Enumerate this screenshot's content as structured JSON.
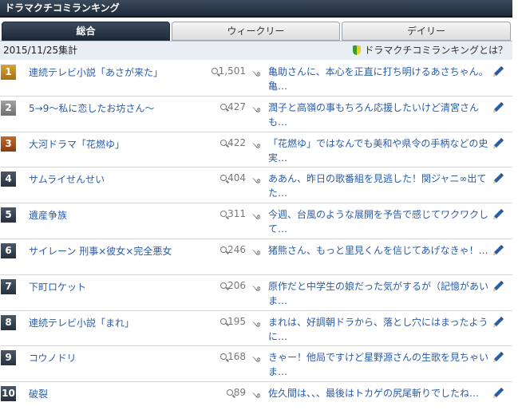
{
  "header": {
    "title": "ドラマクチコミランキング"
  },
  "tabs": [
    {
      "label": "総合",
      "active": true
    },
    {
      "label": "ウィークリー",
      "active": false
    },
    {
      "label": "デイリー",
      "active": false
    }
  ],
  "info": {
    "date": "2015/11/25集計",
    "help_link": "ドラマクチコミランキングとは？"
  },
  "rows": [
    {
      "rank": "1",
      "title": "連続テレビ小説「あさが来た」",
      "count": "1,501",
      "comment": "亀助さんに、本心を正直に打ち明けるあさちゃん。亀…"
    },
    {
      "rank": "2",
      "title": "5→9～私に恋したお坊さん～",
      "count": "427",
      "comment": "潤子と高嶺の事もちろん応援したいけど清宮さんも…"
    },
    {
      "rank": "3",
      "title": "大河ドラマ「花燃ゆ」",
      "count": "422",
      "comment": "「花燃ゆ」ではなんでも美和や県令の手柄などの史実…"
    },
    {
      "rank": "4",
      "title": "サムライせんせい",
      "count": "404",
      "comment": "ああん、昨日の歌番組を見逃した！関ジャニ∞出てた…"
    },
    {
      "rank": "5",
      "title": "遺産争族",
      "count": "311",
      "comment": "今週、台風のような展開を予告で感じてワクワクして…"
    },
    {
      "rank": "6",
      "title": "サイレーン 刑事×彼女×完全悪女",
      "count": "246",
      "comment": "猪熊さん、もっと里見くんを信じてあげなきゃ！…"
    },
    {
      "rank": "7",
      "title": "下町ロケット",
      "count": "206",
      "comment": "原作だと中学生の娘だった気がするが（記憶があいま…"
    },
    {
      "rank": "8",
      "title": "連続テレビ小説「まれ」",
      "count": "195",
      "comment": "まれは、好調朝ドラから、落とし穴にはまったように…"
    },
    {
      "rank": "9",
      "title": "コウノドリ",
      "count": "168",
      "comment": "きゃー！他局ですけど星野源さんの生歌を見ちゃいま…"
    },
    {
      "rank": "10",
      "title": "破裂",
      "count": "89",
      "comment": "佐久間は、、、最後はトカゲの尻尾斬りでしたね…"
    }
  ],
  "colors": {
    "header_dark": "#1f2b3a",
    "link": "#2a5ca8",
    "info_bg": "#e9eef5"
  }
}
